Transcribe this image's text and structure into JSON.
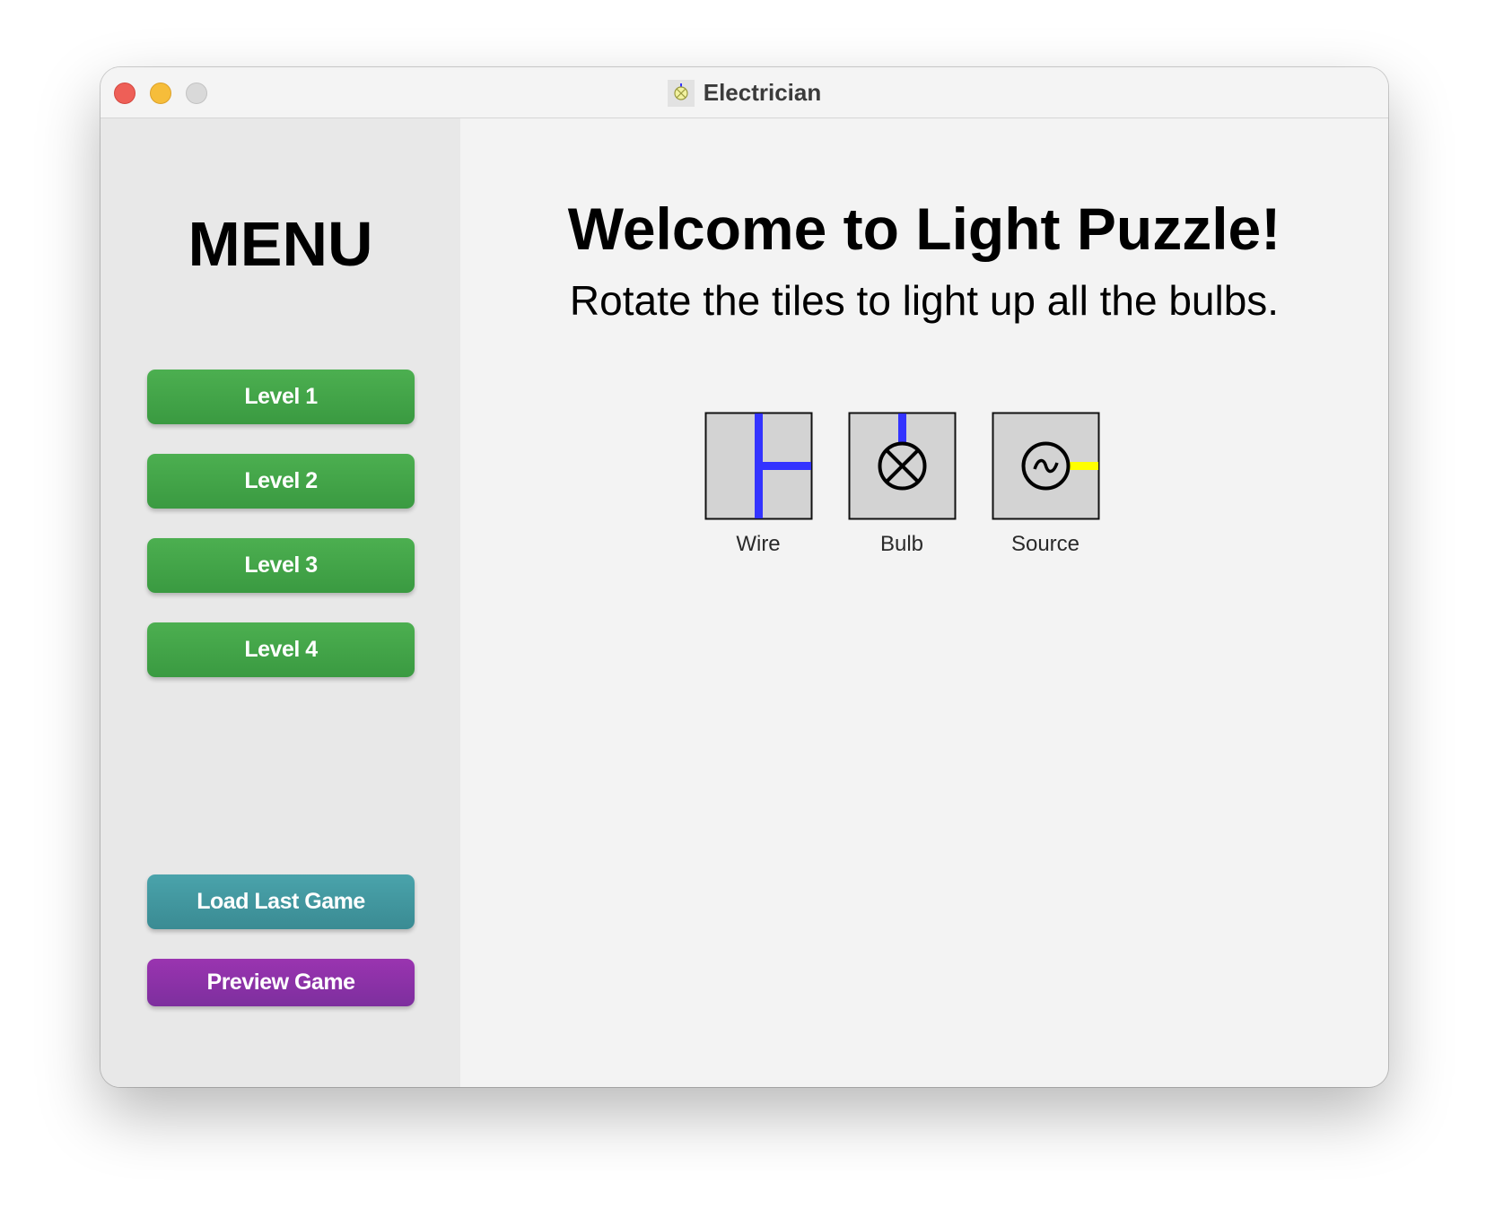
{
  "window": {
    "title": "Electrician"
  },
  "sidebar": {
    "menu_title": "MENU",
    "levels": [
      {
        "label": "Level 1"
      },
      {
        "label": "Level 2"
      },
      {
        "label": "Level 3"
      },
      {
        "label": "Level 4"
      }
    ],
    "load_last_game_label": "Load Last Game",
    "preview_game_label": "Preview Game"
  },
  "main": {
    "welcome_title": "Welcome to Light Puzzle!",
    "instructions": "Rotate the tiles to light up all the bulbs.",
    "legend": [
      {
        "label": "Wire",
        "icon": "wire-tile-icon"
      },
      {
        "label": "Bulb",
        "icon": "bulb-tile-icon"
      },
      {
        "label": "Source",
        "icon": "source-tile-icon"
      }
    ]
  },
  "colors": {
    "level_button": "#43a647",
    "load_button": "#4298a0",
    "preview_button": "#8b32a8",
    "wire": "#3333ff",
    "source_output": "#ffff00",
    "tile_background": "#d3d3d3"
  }
}
